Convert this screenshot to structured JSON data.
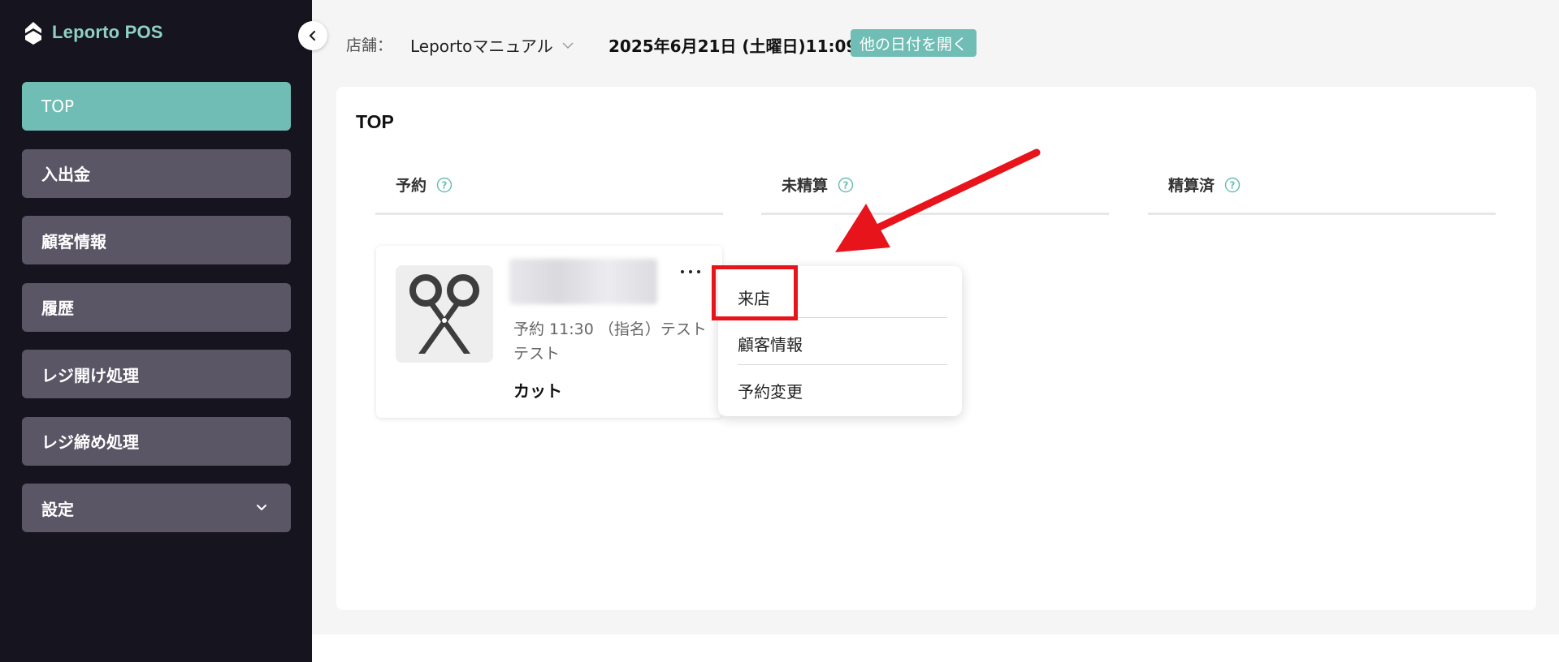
{
  "app": {
    "name": "Leporto POS"
  },
  "sidebar": {
    "items": [
      {
        "label": "TOP",
        "active": true
      },
      {
        "label": "入出金"
      },
      {
        "label": "顧客情報"
      },
      {
        "label": "履歴"
      },
      {
        "label": "レジ開け処理"
      },
      {
        "label": "レジ締め処理"
      },
      {
        "label": "設定",
        "has_submenu": true
      }
    ]
  },
  "header": {
    "store_label": "店舗：",
    "store_value": "Leportoマニュアル",
    "date": "2025年6月21日 (土曜日)11:09",
    "other_date_button": "他の日付を開く"
  },
  "main": {
    "title": "TOP",
    "columns": [
      {
        "label": "予約"
      },
      {
        "label": "未精算"
      },
      {
        "label": "精算済"
      }
    ],
    "card": {
      "time": "予約 11:30 （指名）テスト テスト",
      "menu": "カット"
    },
    "dropdown": {
      "items": [
        "来店",
        "顧客情報",
        "予約変更"
      ]
    }
  },
  "colors": {
    "accent": "#6fbdb4",
    "sidebar_bg": "#16141f",
    "nav_item_bg": "#5a5666",
    "annotation_red": "#e8141b"
  },
  "icons": {
    "logo": "leporto-logo-icon",
    "collapse": "chevron-left-icon",
    "store_dropdown": "chevron-down-icon",
    "help": "question-circle-icon",
    "thumbnail": "scissors-icon",
    "more": "more-horizontal-icon"
  }
}
